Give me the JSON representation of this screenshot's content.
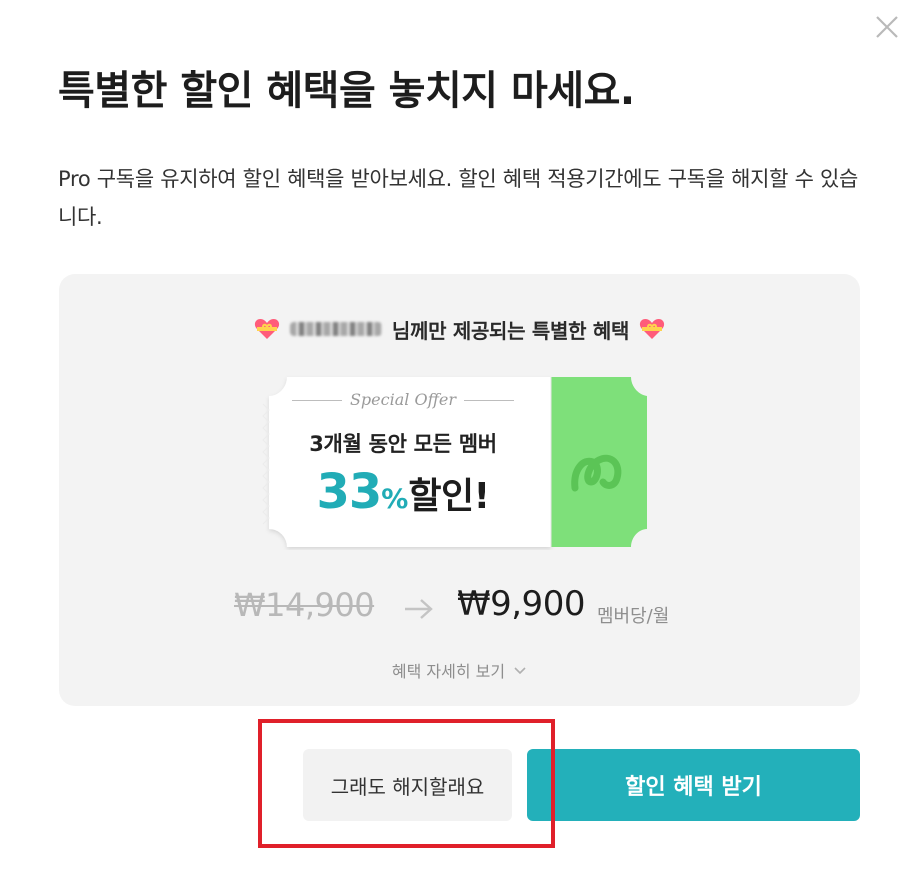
{
  "dialog": {
    "title": "특별한 할인 혜택을 놓치지 마세요.",
    "description": "Pro 구독을 유지하여 할인 혜택을 받아보세요. 할인 혜택 적용기간에도 구독을 해지할 수 있습니다.",
    "close_icon": "close-icon"
  },
  "offer": {
    "personal_message": "님께만 제공되는 특별한 혜택",
    "heart_icon": "heart-gift-icon",
    "ticket": {
      "special_label": "Special Offer",
      "line1": "3개월 동안 모든 멤버",
      "discount_number": "33",
      "discount_percent": "%",
      "discount_word": "할인!"
    },
    "old_price": "₩14,900",
    "new_price": "₩9,900",
    "unit": "멤버당/월",
    "detail_link": "혜택 자세히 보기"
  },
  "buttons": {
    "cancel_label": "그래도 해지할래요",
    "accept_label": "할인 혜택 받기"
  },
  "colors": {
    "accent": "#23b0ba",
    "ticket_stub": "#7ee07a",
    "highlight": "#e0202a",
    "card_bg": "#f3f3f3"
  }
}
